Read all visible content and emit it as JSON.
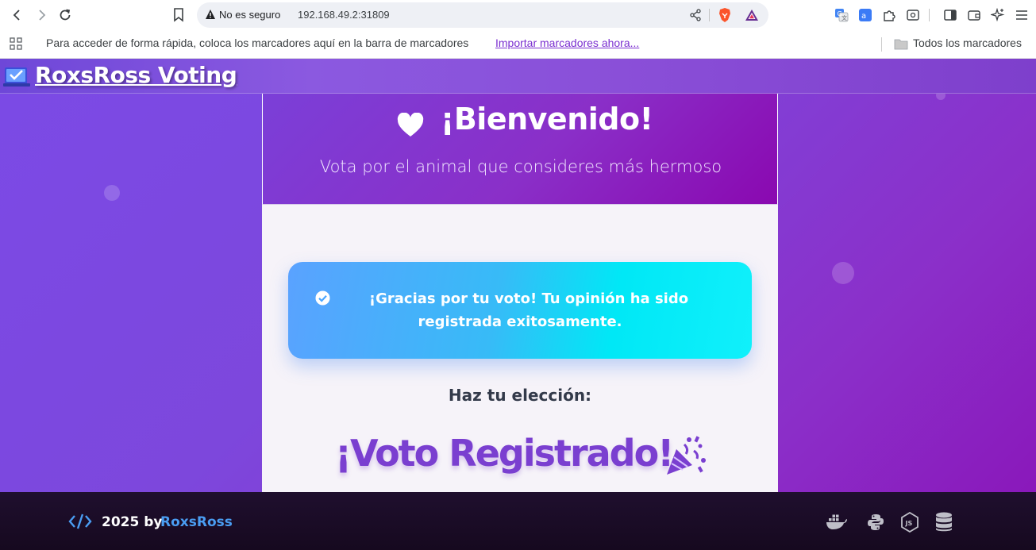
{
  "browser": {
    "security_label": "No es seguro",
    "url": "192.168.49.2:31809",
    "bookmarks_prompt": "Para acceder de forma rápida, coloca los marcadores aquí en la barra de marcadores",
    "import_link": "Importar marcadores ahora...",
    "all_bookmarks": "Todos los marcadores"
  },
  "app": {
    "brand": "RoxsRoss Voting",
    "welcome_title": "¡Bienvenido!",
    "welcome_subtitle": "Vota por el animal que consideres más hermoso",
    "success_message": "¡Gracias por tu voto! Tu opinión ha sido registrada exitosamente.",
    "choose_heading": "Haz tu elección:",
    "vote_registered": "¡Voto Registrado!"
  },
  "footer": {
    "year_by": "2025 by",
    "author": "RoxsRoss",
    "tech_icons": [
      "docker-icon",
      "python-icon",
      "nodejs-icon",
      "database-icon"
    ]
  },
  "colors": {
    "accent_purple": "#7a3fd0",
    "alert_start": "#5aa2ff",
    "alert_end": "#00e8f6",
    "footer_bg": "#1a0c26",
    "author_blue": "#4a9df2"
  }
}
